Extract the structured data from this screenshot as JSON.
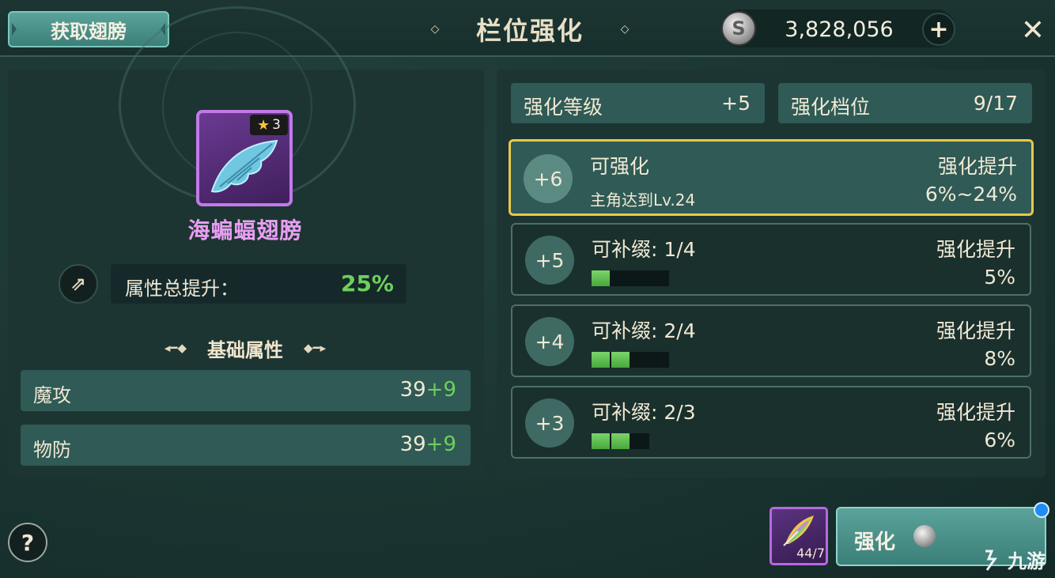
{
  "header": {
    "get_wings_label": "获取翅膀",
    "title": "栏位强化",
    "coins": "3,828,056",
    "coin_icon_letter": "S",
    "plus_label": "+",
    "close_label": "✕"
  },
  "item": {
    "name": "海蝙蝠翅膀",
    "stars": "3",
    "total_boost_label": "属性总提升：",
    "total_boost_value": "25%"
  },
  "base_attrs": {
    "section_title": "基础属性",
    "rows": [
      {
        "name": "魔攻",
        "base": "39",
        "bonus": "+9"
      },
      {
        "name": "物防",
        "base": "39",
        "bonus": "+9"
      }
    ]
  },
  "enhance": {
    "level_label": "强化等级",
    "level_value": "+5",
    "tier_label": "强化档位",
    "tier_value": "9/17"
  },
  "tiers": [
    {
      "level": "+6",
      "status": "可强化",
      "condition": "主角达到Lv.24",
      "boost_label": "强化提升",
      "boost_value": "6%~24%",
      "active": true
    },
    {
      "level": "+5",
      "status": "可补缀: 1/4",
      "filled": 1,
      "total": 4,
      "boost_label": "强化提升",
      "boost_value": "5%"
    },
    {
      "level": "+4",
      "status": "可补缀: 2/4",
      "filled": 2,
      "total": 4,
      "boost_label": "强化提升",
      "boost_value": "8%"
    },
    {
      "level": "+3",
      "status": "可补缀: 2/3",
      "filled": 2,
      "total": 3,
      "boost_label": "强化提升",
      "boost_value": "6%"
    }
  ],
  "footer": {
    "help_label": "?",
    "feather_count": "44/7",
    "enhance_button": "强化",
    "watermark": "九游"
  },
  "colors": {
    "accent_green": "#6fcf5c",
    "item_purple": "#e99ef3",
    "active_border": "#e8c84a",
    "panel": "#2f5a55"
  }
}
